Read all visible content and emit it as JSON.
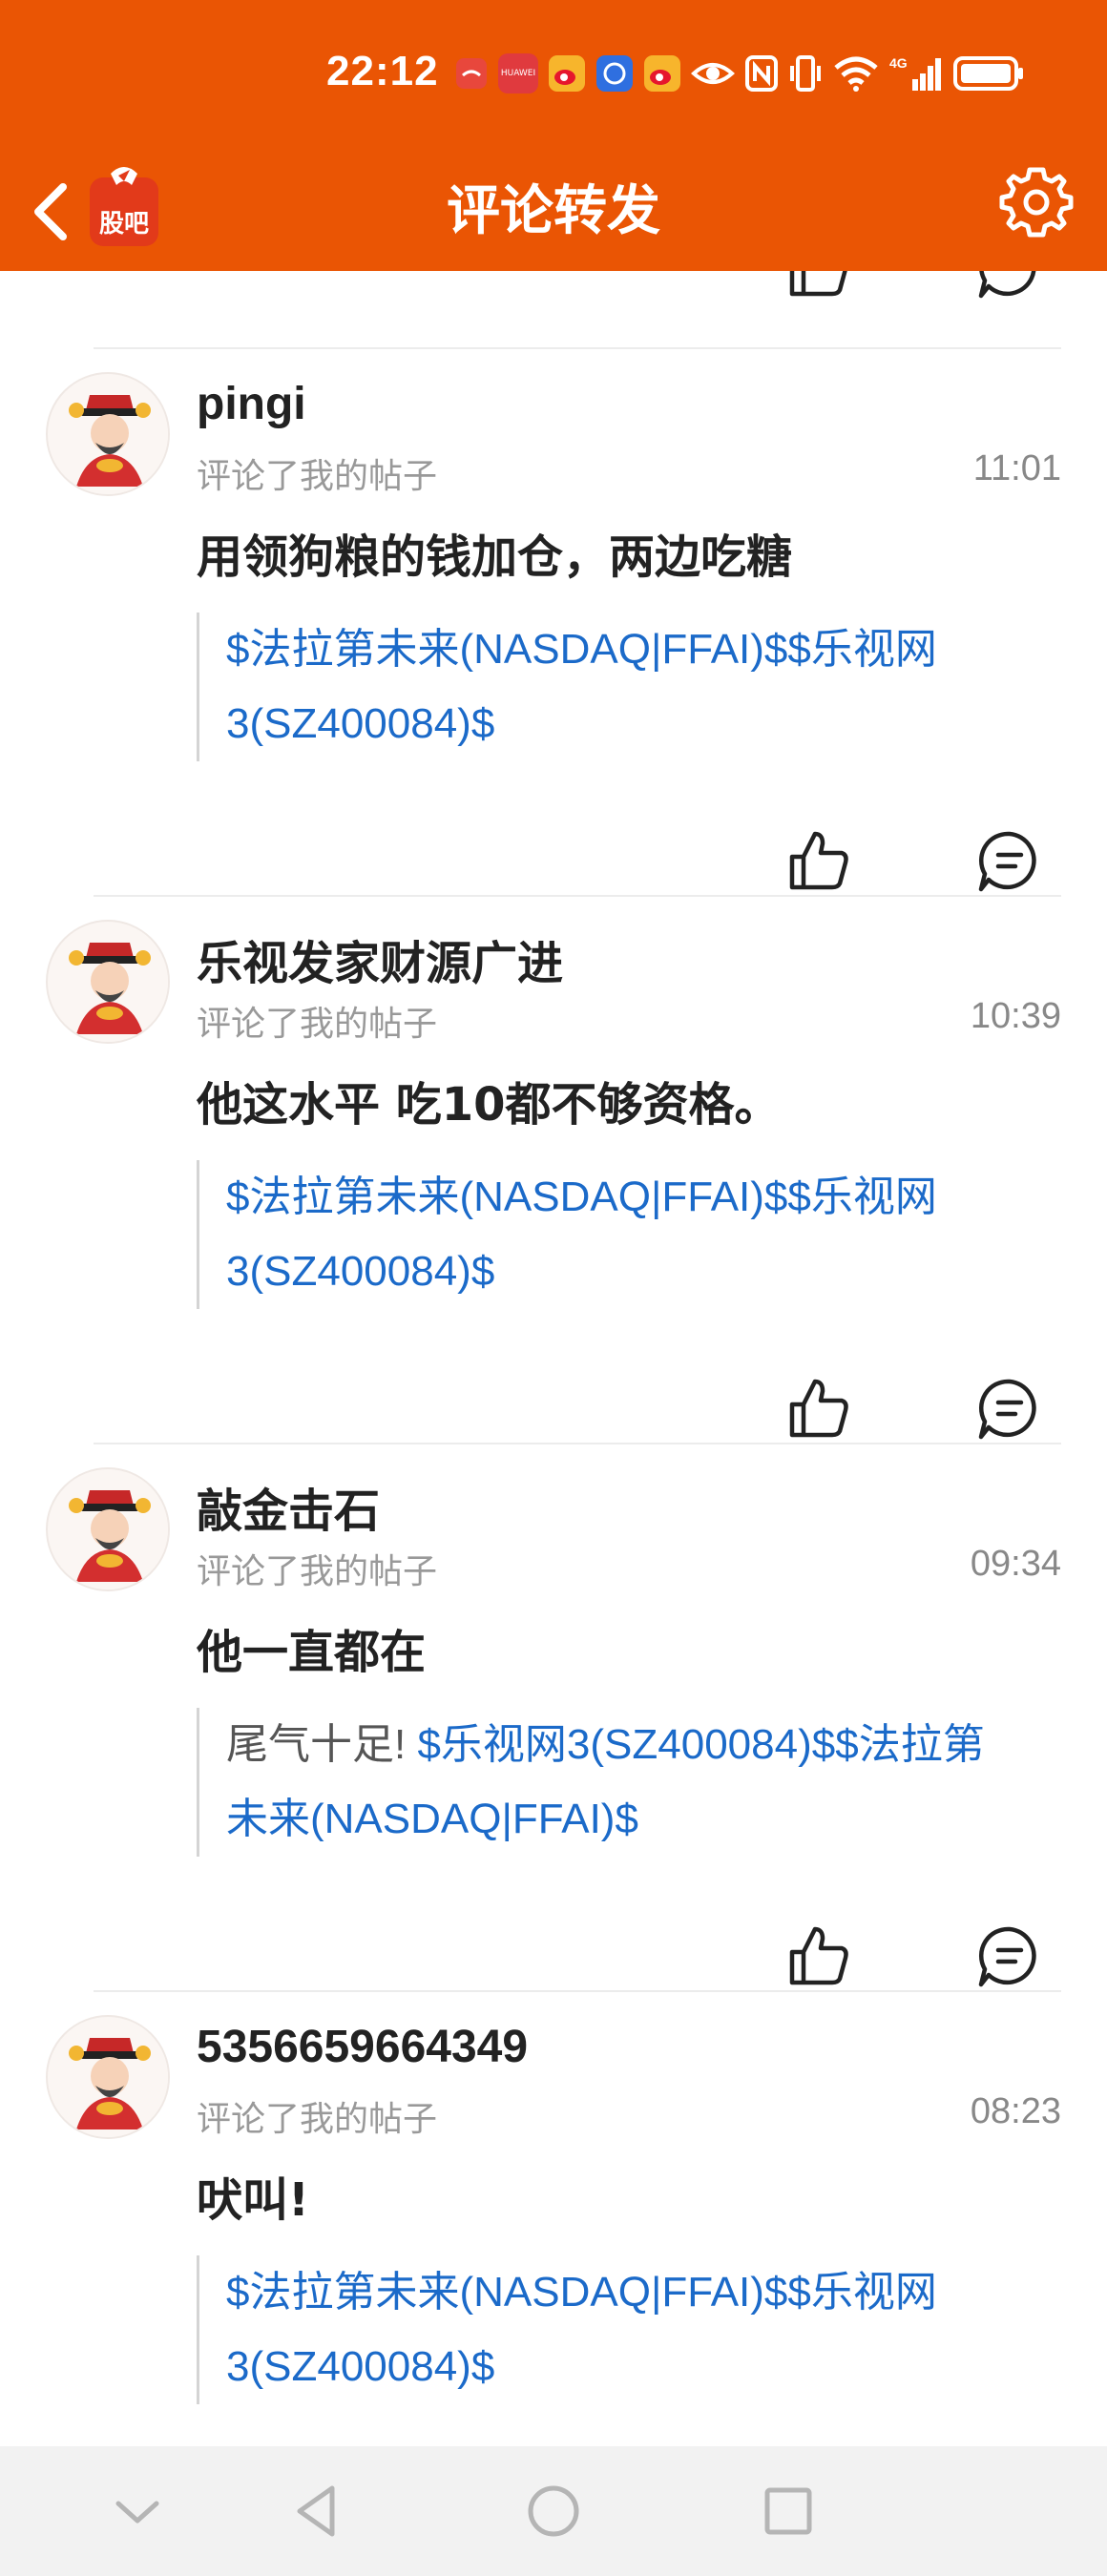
{
  "status_bar": {
    "time": "22:12",
    "icons": [
      "missed-call-icon",
      "huawei-icon",
      "weibo-icon",
      "app-icon",
      "weibo-icon",
      "eye-icon",
      "nfc-icon",
      "vibrate-icon",
      "wifi-icon",
      "signal-4g-icon",
      "battery-icon"
    ],
    "huawei_text": "HUAWEI"
  },
  "header": {
    "title": "评论转发",
    "logo_text": "股吧",
    "background": "#ea5504"
  },
  "comments": [
    {
      "username": "pingi",
      "action": "评论了我的帖子",
      "time": "11:01",
      "text": "用领狗粮的钱加仓，两边吃糖",
      "quote_prefix": "",
      "quote_line1": "$法拉第未来(NASDAQ|FFAI)$$乐视网",
      "quote_line2": "3(SZ400084)$"
    },
    {
      "username": "乐视发家财源广进",
      "action": "评论了我的帖子",
      "time": "10:39",
      "text": "他这水平 吃10都不够资格。",
      "quote_prefix": "",
      "quote_line1": "$法拉第未来(NASDAQ|FFAI)$$乐视网",
      "quote_line2": "3(SZ400084)$"
    },
    {
      "username": "敲金击石",
      "action": "评论了我的帖子",
      "time": "09:34",
      "text": "他一直都在",
      "quote_prefix": "尾气十足! ",
      "quote_line1": "$乐视网3(SZ400084)$$法拉第",
      "quote_line2": "未来(NASDAQ|FFAI)$"
    },
    {
      "username": "5356659664349",
      "action": "评论了我的帖子",
      "time": "08:23",
      "text": "吠叫!",
      "quote_prefix": "",
      "quote_line1": "$法拉第未来(NASDAQ|FFAI)$$乐视网",
      "quote_line2": "3(SZ400084)$"
    }
  ],
  "colors": {
    "accent": "#ea5504",
    "link": "#1b6ac9"
  }
}
